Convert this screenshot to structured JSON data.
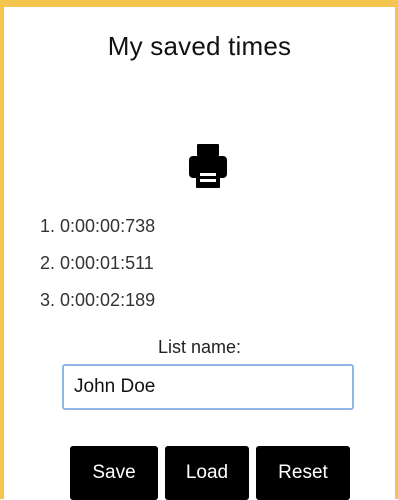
{
  "header": {
    "title": "My saved times"
  },
  "toolbar": {
    "print_icon": "printer-icon"
  },
  "times": [
    "1. 0:00:00:738",
    "2. 0:00:01:511",
    "3. 0:00:02:189"
  ],
  "list_form": {
    "label": "List name:",
    "value": "John Doe"
  },
  "buttons": {
    "save_label": "Save",
    "load_label": "Load",
    "reset_label": "Reset"
  },
  "colors": {
    "border_accent": "#f4c650",
    "button_bg": "#000000",
    "input_border": "#8eb6e6"
  }
}
